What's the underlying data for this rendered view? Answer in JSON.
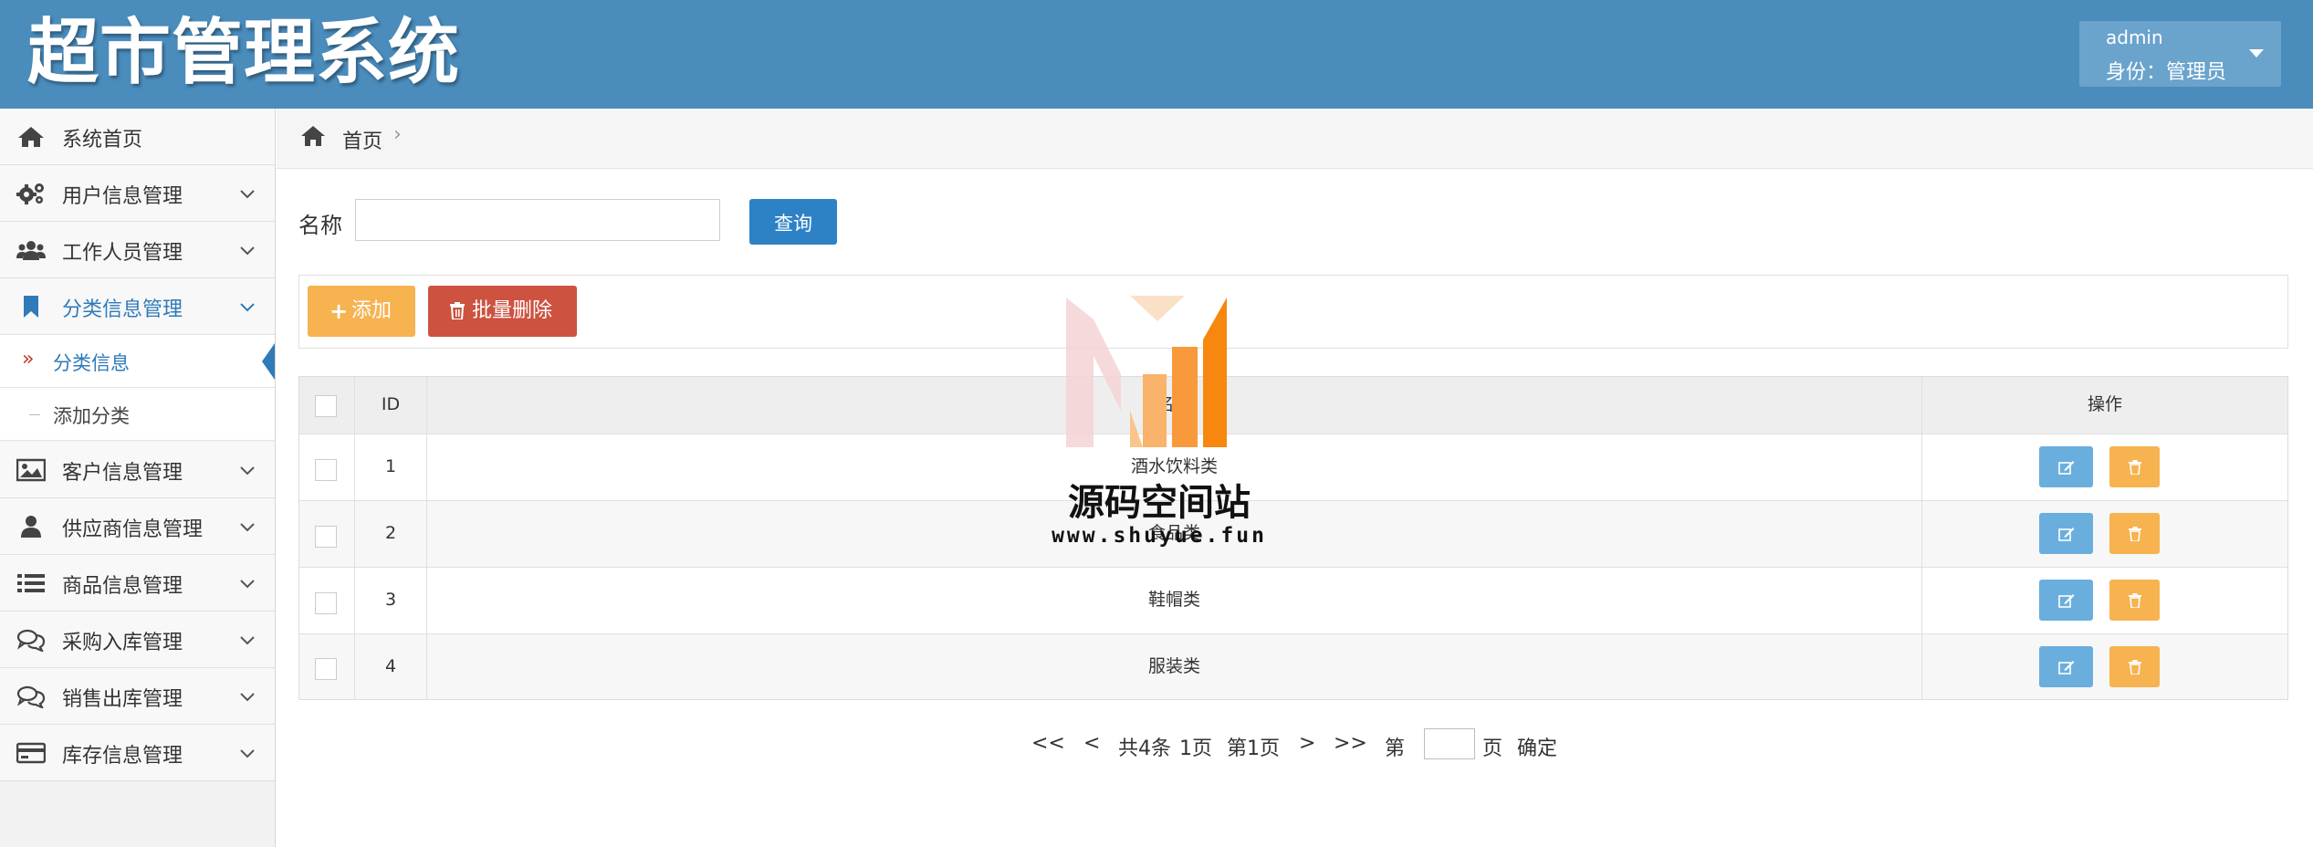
{
  "header": {
    "app_title": "超市管理系统",
    "user": {
      "name": "admin",
      "role_label": "身份：管理员"
    }
  },
  "sidebar": {
    "items": [
      {
        "label": "系统首页",
        "icon": "home-icon"
      },
      {
        "label": "用户信息管理",
        "icon": "gears-icon"
      },
      {
        "label": "工作人员管理",
        "icon": "users-icon"
      },
      {
        "label": "分类信息管理",
        "icon": "bookmark-icon",
        "expanded": true
      },
      {
        "label": "客户信息管理",
        "icon": "picture-icon"
      },
      {
        "label": "供应商信息管理",
        "icon": "user-icon"
      },
      {
        "label": "商品信息管理",
        "icon": "list-icon"
      },
      {
        "label": "采购入库管理",
        "icon": "comments-icon"
      },
      {
        "label": "销售出库管理",
        "icon": "comments-icon"
      },
      {
        "label": "库存信息管理",
        "icon": "credit-card-icon"
      }
    ],
    "sub_items": [
      {
        "label": "分类信息",
        "active": true
      },
      {
        "label": "添加分类"
      }
    ]
  },
  "breadcrumb": {
    "home": "首页",
    "separator": "›"
  },
  "search": {
    "label": "名称",
    "value": "",
    "button": "查询"
  },
  "toolbar": {
    "add": "添加",
    "batch_delete": "批量删除"
  },
  "table": {
    "columns": [
      "ID",
      "名称",
      "操作"
    ],
    "rows": [
      {
        "id": "1",
        "name": "酒水饮料类"
      },
      {
        "id": "2",
        "name": "食品类"
      },
      {
        "id": "3",
        "name": "鞋帽类"
      },
      {
        "id": "4",
        "name": "服装类"
      }
    ]
  },
  "pagination": {
    "first": "<<",
    "prev": "<",
    "total": "共4条",
    "pages": "1页",
    "current": "第1页",
    "next": ">",
    "last": ">>",
    "goto_prefix": "第",
    "goto_suffix": "页",
    "confirm": "确定",
    "goto_value": ""
  },
  "watermark": {
    "title": "源码空间站",
    "url": "www.shuyue.fun"
  },
  "colors": {
    "header": "#4a8cbc",
    "primary": "#2d82c6",
    "warning": "#f7b350",
    "danger": "#cd5240",
    "info": "#6aaede"
  }
}
